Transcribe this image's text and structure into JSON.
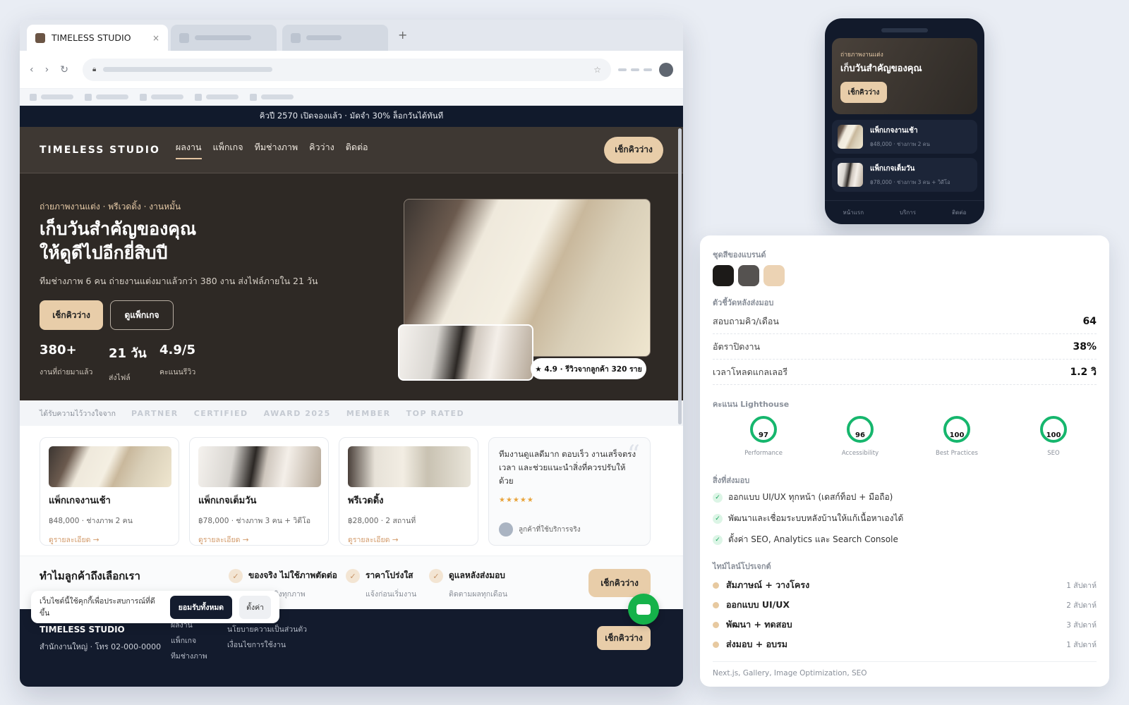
{
  "browser": {
    "tab_title": "TIMELESS STUDIO",
    "tab_close": "×",
    "new_tab": "+"
  },
  "announce": "คิวปี 2570 เปิดจองแล้ว · มัดจำ 30% ล็อกวันได้ทันที",
  "header": {
    "logo": "TIMELESS STUDIO",
    "menu": [
      "ผลงาน",
      "แพ็กเกจ",
      "ทีมช่างภาพ",
      "คิวว่าง",
      "ติดต่อ"
    ],
    "cta": "เช็กคิวว่าง"
  },
  "hero": {
    "eyebrow": "ถ่ายภาพงานแต่ง · พรีเวดดิ้ง · งานหมั้น",
    "title_line1": "เก็บวันสำคัญของคุณ",
    "title_line2": "ให้ดูดีไปอีกยี่สิบปี",
    "subtitle": "ทีมช่างภาพ 6 คน ถ่ายงานแต่งมาแล้วกว่า 380 งาน ส่งไฟล์ภายใน 21 วัน",
    "cta_primary": "เช็กคิวว่าง",
    "cta_secondary": "ดูแพ็กเกจ",
    "stats": [
      {
        "value": "380+",
        "label": "งานที่ถ่ายมาแล้ว"
      },
      {
        "value": "21 วัน",
        "label": "ส่งไฟล์"
      },
      {
        "value": "4.9/5",
        "label": "คะแนนรีวิว"
      }
    ],
    "rating_badge": "★ 4.9 · รีวิวจากลูกค้า 320 ราย"
  },
  "partners": {
    "label": "ได้รับความไว้วางใจจาก",
    "items": [
      "PARTNER",
      "CERTIFIED",
      "AWARD 2025",
      "MEMBER",
      "TOP RATED"
    ]
  },
  "packages": [
    {
      "title": "แพ็กเกจงานเช้า",
      "meta": "฿48,000 · ช่างภาพ 2 คน",
      "link": "ดูรายละเอียด →"
    },
    {
      "title": "แพ็กเกจเต็มวัน",
      "meta": "฿78,000 · ช่างภาพ 3 คน + วิดีโอ",
      "link": "ดูรายละเอียด →"
    },
    {
      "title": "พรีเวดดิ้ง",
      "meta": "฿28,000 · 2 สถานที่",
      "link": "ดูรายละเอียด →"
    }
  ],
  "testimonial": {
    "quote": "ทีมงานดูแลดีมาก ตอบเร็ว งานเสร็จตรงเวลา และช่วยแนะนำสิ่งที่ควรปรับให้ด้วย",
    "stars": "★★★★★",
    "author": "ลูกค้าที่ใช้บริการจริง",
    "quote_mark": "“"
  },
  "why": {
    "title": "ทำไมลูกค้าถึงเลือกเรา",
    "features": [
      {
        "title": "ของจริง ไม่ใช้ภาพตัดต่อ",
        "sub": "ผลงานจริงทุกภาพ"
      },
      {
        "title": "ราคาโปร่งใส",
        "sub": "แจ้งก่อนเริ่มงาน"
      },
      {
        "title": "ดูแลหลังส่งมอบ",
        "sub": "ติดตามผลทุกเดือน"
      }
    ],
    "cta": "เช็กคิวว่าง"
  },
  "footer": {
    "brand": "TIMELESS STUDIO",
    "address": "สำนักงานใหญ่ · โทร 02-000-0000",
    "col1": [
      "ผลงาน",
      "แพ็กเกจ",
      "ทีมช่างภาพ"
    ],
    "col2": [
      "นโยบายความเป็นส่วนตัว",
      "เงื่อนไขการใช้งาน"
    ],
    "cta": "เช็กคิวว่าง"
  },
  "cookie": {
    "text": "เว็บไซต์นี้ใช้คุกกี้เพื่อประสบการณ์ที่ดีขึ้น",
    "accept": "ยอมรับทั้งหมด",
    "settings": "ตั้งค่า"
  },
  "phone": {
    "eyebrow": "ถ่ายภาพงานแต่ง",
    "title": "เก็บวันสำคัญของคุณ",
    "cta": "เช็กคิวว่าง",
    "items": [
      {
        "title": "แพ็กเกจงานเช้า",
        "meta": "฿48,000 · ช่างภาพ 2 คน"
      },
      {
        "title": "แพ็กเกจเต็มวัน",
        "meta": "฿78,000 · ช่างภาพ 3 คน + วิดีโอ"
      }
    ],
    "nav": [
      "หน้าแรก",
      "บริการ",
      "ติดต่อ"
    ]
  },
  "panel": {
    "palette_title": "ชุดสีของแบรนด์",
    "palette": [
      "#1c1a18",
      "#555250",
      "#ecd3b4"
    ],
    "metrics_title": "ตัวชี้วัดหลังส่งมอบ",
    "metrics": [
      {
        "label": "สอบถามคิว/เดือน",
        "value": "64"
      },
      {
        "label": "อัตราปิดงาน",
        "value": "38%"
      },
      {
        "label": "เวลาโหลดแกลเลอรี",
        "value": "1.2 วิ"
      }
    ],
    "lighthouse_title": "คะแนน Lighthouse",
    "lighthouse": [
      {
        "label": "Performance",
        "score": "97"
      },
      {
        "label": "Accessibility",
        "score": "96"
      },
      {
        "label": "Best Practices",
        "score": "100"
      },
      {
        "label": "SEO",
        "score": "100"
      }
    ],
    "deliverables_title": "สิ่งที่ส่งมอบ",
    "deliverables": [
      "ออกแบบ UI/UX ทุกหน้า (เดสก์ท็อป + มือถือ)",
      "พัฒนาและเชื่อมระบบหลังบ้านให้แก้เนื้อหาเองได้",
      "ตั้งค่า SEO, Analytics และ Search Console"
    ],
    "timeline_title": "ไทม์ไลน์โปรเจกต์",
    "timeline": [
      {
        "step": "สัมภาษณ์ + วางโครง",
        "duration": "1 สัปดาห์"
      },
      {
        "step": "ออกแบบ UI/UX",
        "duration": "2 สัปดาห์"
      },
      {
        "step": "พัฒนา + ทดสอบ",
        "duration": "3 สัปดาห์"
      },
      {
        "step": "ส่งมอบ + อบรม",
        "duration": "1 สัปดาห์"
      }
    ],
    "stack": "Next.js, Gallery, Image Optimization, SEO"
  }
}
